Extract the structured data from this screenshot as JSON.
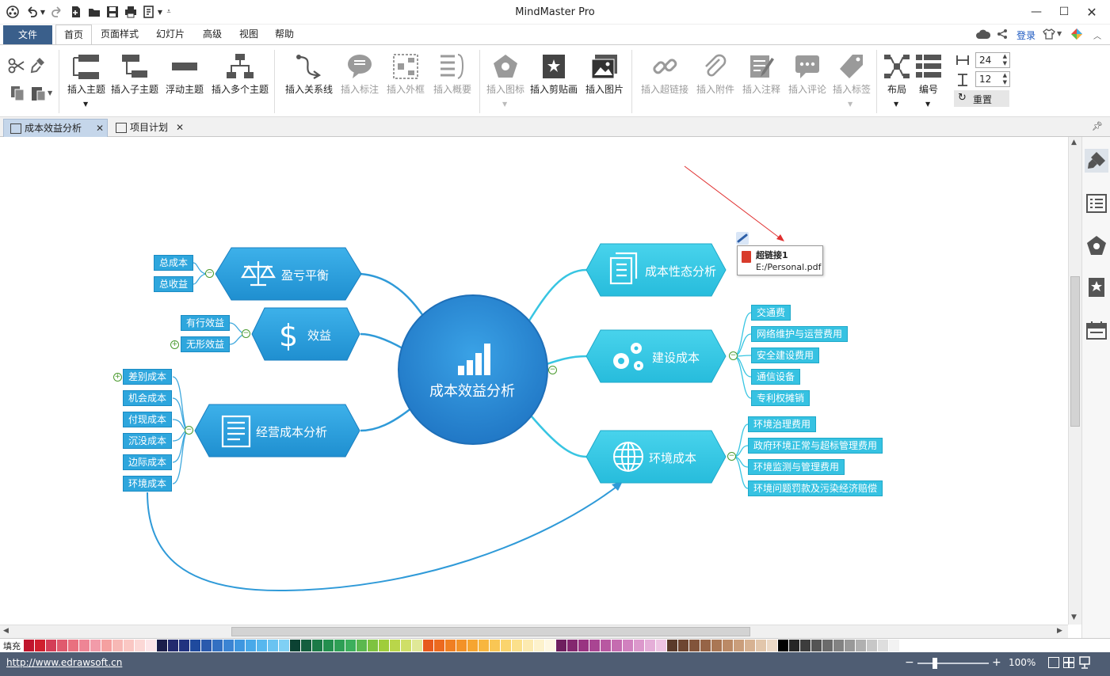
{
  "app": {
    "title": "MindMaster Pro"
  },
  "menu": {
    "file": "文件",
    "tabs": [
      "首页",
      "页面样式",
      "幻灯片",
      "高级",
      "视图",
      "帮助"
    ],
    "login": "登录"
  },
  "ribbon": {
    "insert_topic": "插入主题",
    "insert_subtopic": "插入子主题",
    "floating_topic": "浮动主题",
    "insert_multiple": "插入多个主题",
    "insert_relationship": "插入关系线",
    "insert_callout": "插入标注",
    "insert_boundary": "插入外框",
    "insert_summary": "插入概要",
    "insert_icon": "插入图标",
    "insert_clipart": "插入剪贴画",
    "insert_image": "插入图片",
    "insert_hyperlink": "插入超链接",
    "insert_attachment": "插入附件",
    "insert_note": "插入注释",
    "insert_comment": "插入评论",
    "insert_tag": "插入标签",
    "layout": "布局",
    "numbering": "编号",
    "h_spacing": "24",
    "v_spacing": "12",
    "reset": "重置"
  },
  "doc_tabs": [
    {
      "label": "成本效益分析"
    },
    {
      "label": "项目计划"
    }
  ],
  "mindmap": {
    "central": "成本效益分析",
    "left_topics": [
      {
        "label": "盈亏平衡",
        "icon": "scale-icon",
        "children": [
          "总成本",
          "总收益"
        ]
      },
      {
        "label": "效益",
        "icon": "dollar-icon",
        "children": [
          "有行效益",
          "无形效益"
        ]
      },
      {
        "label": "经营成本分析",
        "icon": "document-icon",
        "children": [
          "差别成本",
          "机会成本",
          "付现成本",
          "沉没成本",
          "边际成本",
          "环境成本"
        ]
      }
    ],
    "right_topics": [
      {
        "label": "成本性态分析",
        "icon": "documents-icon",
        "children": []
      },
      {
        "label": "建设成本",
        "icon": "gears-icon",
        "children": [
          "交通费",
          "网络维护与运营费用",
          "安全建设费用",
          "通信设备",
          "专利权摊销"
        ]
      },
      {
        "label": "环境成本",
        "icon": "globe-icon",
        "children": [
          "环境治理费用",
          "政府环境正常与超标管理费用",
          "环境监测与管理费用",
          "环境问题罚款及污染经济赔偿"
        ]
      }
    ],
    "hyperlink_tooltip": {
      "title": "超链接1",
      "path": "E:/Personal.pdf"
    }
  },
  "palette": {
    "label": "填充",
    "colors": [
      "#c0152d",
      "#d01f2e",
      "#d43d57",
      "#e05a6e",
      "#e9707f",
      "#ee8595",
      "#f29ba9",
      "#f5a0a0",
      "#f7b8b5",
      "#fac7c3",
      "#fcd8d6",
      "#fde6e9",
      "#1b1e4a",
      "#232a6e",
      "#223380",
      "#1f4a9e",
      "#2a5aad",
      "#3370c2",
      "#3b84d3",
      "#3f97e0",
      "#49a9e9",
      "#57b7ee",
      "#6ac3f1",
      "#7fd0f4",
      "#0c4233",
      "#145e3e",
      "#1b7a47",
      "#238f4e",
      "#2e9f55",
      "#3caf5c",
      "#5bb84f",
      "#7ec340",
      "#9fcd3b",
      "#b9d64a",
      "#cfdf68",
      "#e0e897",
      "#e75a1d",
      "#ec6a1f",
      "#f07f22",
      "#f39228",
      "#f6a531",
      "#f8b63f",
      "#f9c654",
      "#fad46d",
      "#fbe08b",
      "#fceab0",
      "#fdf2cc",
      "#fef7e2",
      "#6e1f5e",
      "#84286f",
      "#993481",
      "#a94592",
      "#b858a1",
      "#c56cb0",
      "#d181bf",
      "#dc98cc",
      "#e5aed8",
      "#eec4e3",
      "#5a3a2a",
      "#6e4632",
      "#82543b",
      "#966446",
      "#aa7754",
      "#bb8a66",
      "#ca9e7b",
      "#d7b292",
      "#e2c6ab",
      "#ecd9c6",
      "#000000",
      "#262626",
      "#3d3d3d",
      "#545454",
      "#6b6b6b",
      "#828282",
      "#999999",
      "#b0b0b0",
      "#c7c7c7",
      "#dedede",
      "#f2f2f2",
      "#ffffff"
    ]
  },
  "status": {
    "url": "http://www.edrawsoft.cn",
    "zoom": "100%"
  }
}
